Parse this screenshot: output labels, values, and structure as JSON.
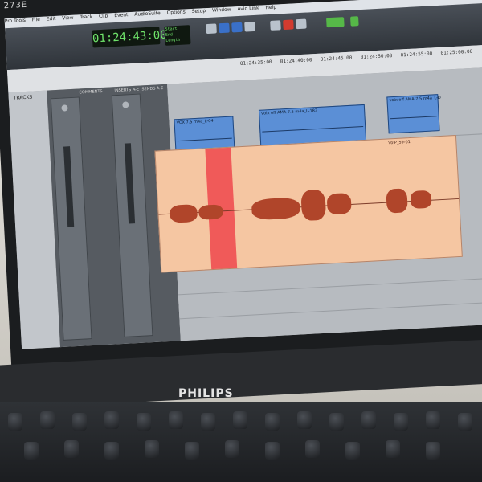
{
  "monitor": {
    "model": "273E",
    "brand": "PHILIPS"
  },
  "app": {
    "title": "Pro Tools",
    "menu": [
      "File",
      "Edit",
      "View",
      "Track",
      "Clip",
      "Event",
      "AudioSuite",
      "Options",
      "Setup",
      "Window",
      "Avid Link",
      "Help"
    ]
  },
  "transport": {
    "counter": "01:24:43:00",
    "labels": {
      "start": "Start",
      "end": "End",
      "length": "Length"
    }
  },
  "ruler": {
    "timecode": [
      "01:24:35:00",
      "01:24:40:00",
      "01:24:45:00",
      "01:24:50:00",
      "01:24:55:00",
      "01:25:00:00"
    ]
  },
  "left_panel": {
    "tracks_title": "TRACKS"
  },
  "mixer": {
    "comments": "COMMENTS",
    "inserts": "INSERTS A-E",
    "sends": "SENDS A-E"
  },
  "clips": [
    {
      "name": "VOX 7.5 m4a_L-04"
    },
    {
      "name": "voix off AMA 7.5 m4a_L-183"
    },
    {
      "name": "voix off AMA 7.5 m4a_L-D"
    }
  ],
  "big_clip": {
    "name": "VoIP_59-01"
  },
  "colors": {
    "clip_blue": "#5b8fd6",
    "selection_red": "#f05a59",
    "clip_salmon": "#f5c6a2",
    "counter_green": "#6fe36a"
  }
}
